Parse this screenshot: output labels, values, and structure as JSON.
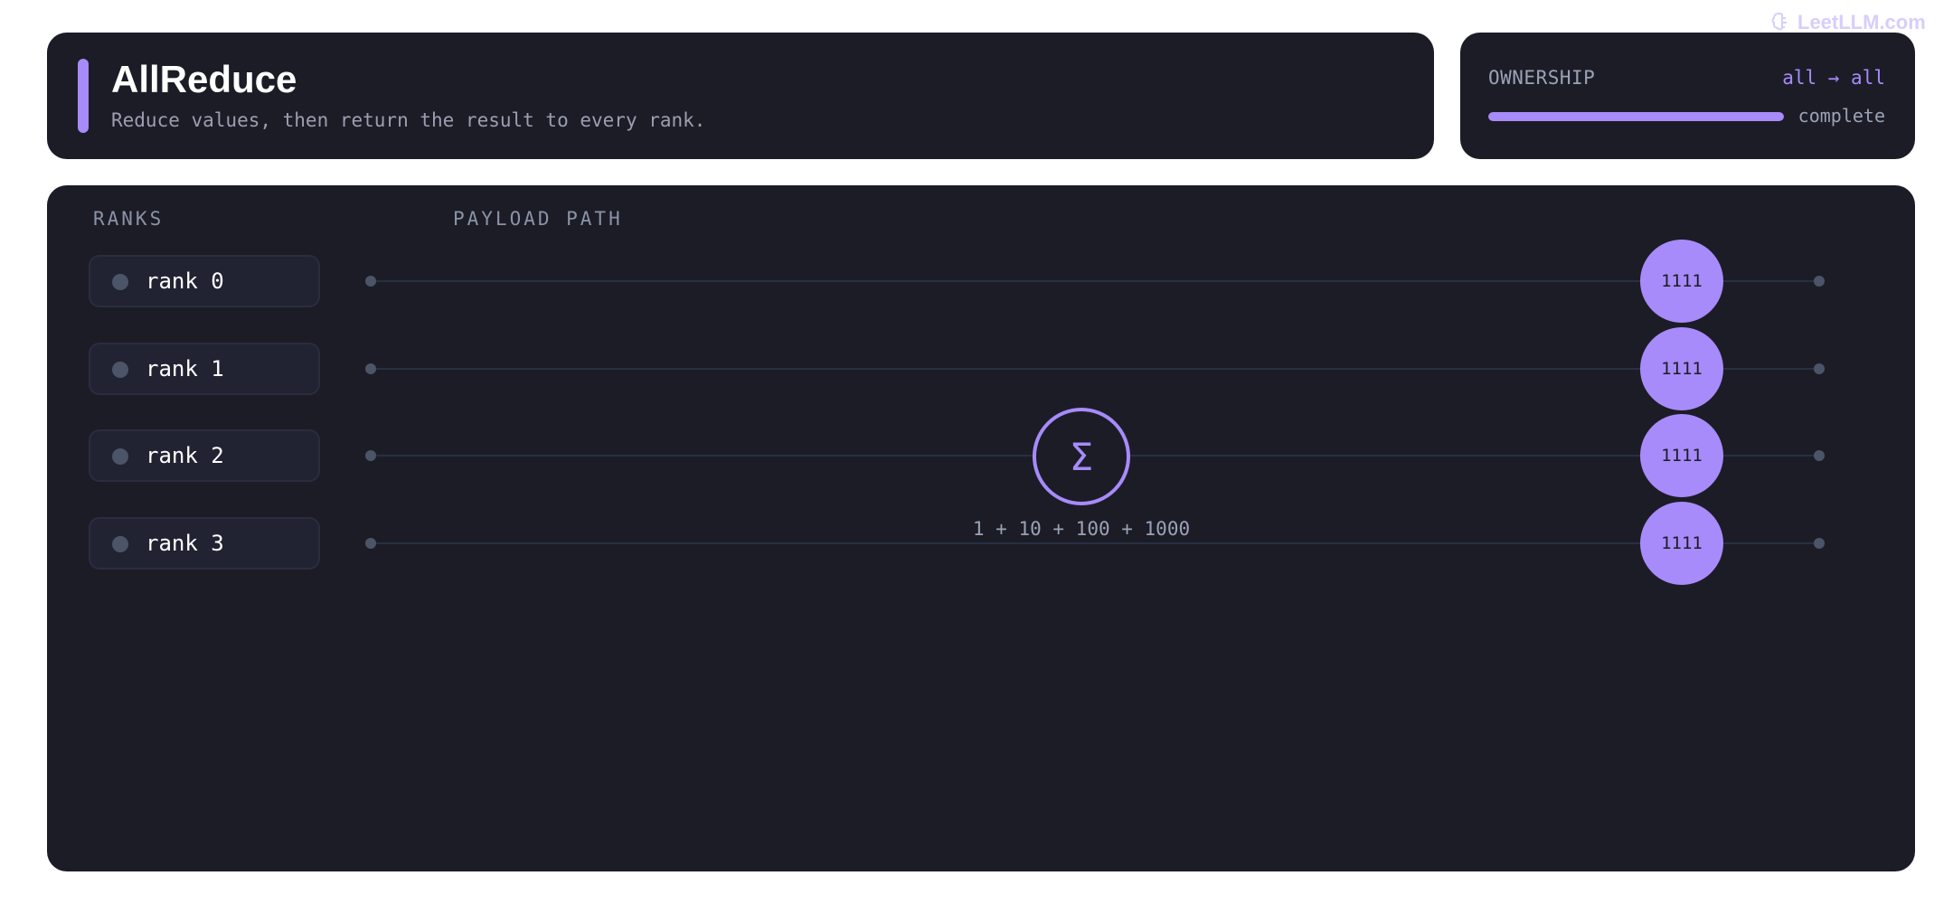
{
  "watermark": {
    "text": "LeetLLM.com",
    "icon": "brain-icon"
  },
  "header": {
    "title": "AllReduce",
    "subtitle": "Reduce values, then return the result to every rank.",
    "accent_color": "#a78bfa"
  },
  "ownership": {
    "label": "OWNERSHIP",
    "value": "all → all",
    "progress": 1.0,
    "status": "complete"
  },
  "diagram": {
    "ranks_label": "RANKS",
    "path_label": "PAYLOAD PATH",
    "ranks": [
      {
        "label": "rank 0",
        "result": "1111"
      },
      {
        "label": "rank 1",
        "result": "1111"
      },
      {
        "label": "rank 2",
        "result": "1111"
      },
      {
        "label": "rank 3",
        "result": "1111"
      }
    ],
    "reduce_symbol": "Σ",
    "reduce_expression": "1 + 10 + 100 + 1000"
  },
  "colors": {
    "background": "#1c1c27",
    "accent": "#a78bfa",
    "muted_text": "#9aa3b5",
    "lane": "#283042"
  }
}
